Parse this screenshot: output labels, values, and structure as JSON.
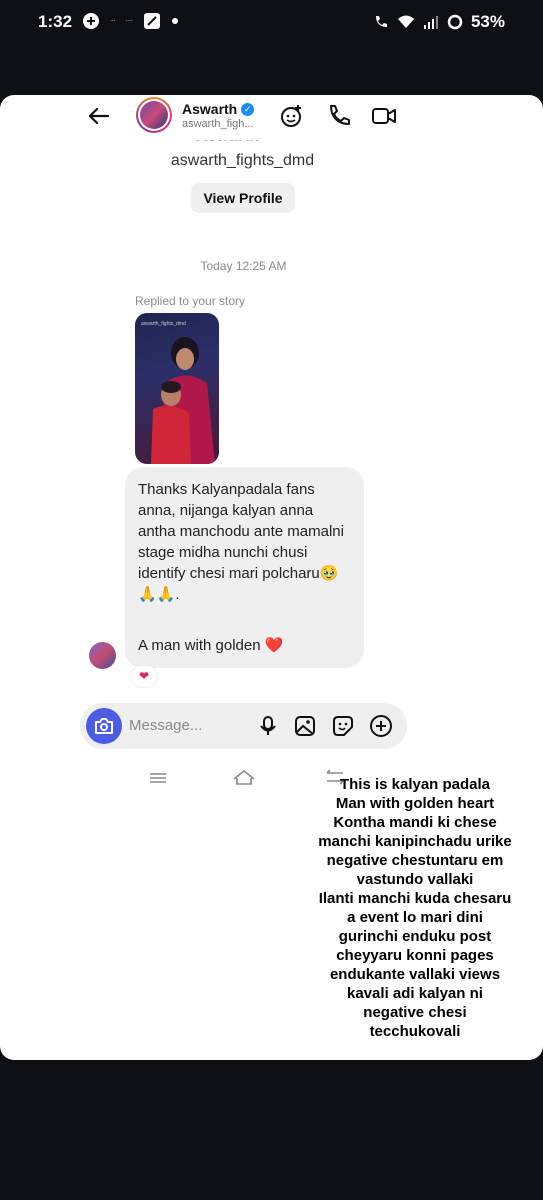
{
  "status_bar": {
    "time": "1:32",
    "battery": "53%",
    "mini_a": "ᐧᐧᐧ",
    "mini_b": "ᐧᐧᐧᐧ"
  },
  "header": {
    "name": "Aswarth",
    "handle": "aswarth_figh..."
  },
  "profile": {
    "ghost_name": "Aswarth",
    "handle": "aswarth_fights_dmd",
    "view_profile": "View Profile"
  },
  "conversation": {
    "timestamp": "Today 12:25 AM",
    "replied": "Replied to your story",
    "story_caption": "aswarth_fights_dmd",
    "message_part1": "Thanks Kalyanpadala fans anna, nijanga kalyan anna antha manchodu ante mamalni stage midha nunchi chusi identify chesi mari polcharu🥹🙏🙏.",
    "message_part2": "A man with golden ❤️",
    "reaction": "❤"
  },
  "composer": {
    "placeholder": "Message..."
  },
  "overlay": {
    "lines": [
      "This is kalyan padala",
      "Man with golden heart",
      "Kontha mandi ki chese",
      "manchi kanipinchadu urike",
      "negative chestuntaru em",
      "vastundo vallaki",
      "Ilanti manchi kuda chesaru",
      "a event lo mari dini",
      "gurinchi enduku post",
      "cheyyaru konni pages",
      "endukante vallaki views",
      "kavali adi kalyan ni",
      "negative chesi",
      "tecchukovali"
    ]
  },
  "colors": {
    "background": "#0e1014",
    "card": "#ffffff",
    "bubble": "#efefef",
    "camera_button": "#4b5ce3",
    "verified": "#1a8cff"
  }
}
